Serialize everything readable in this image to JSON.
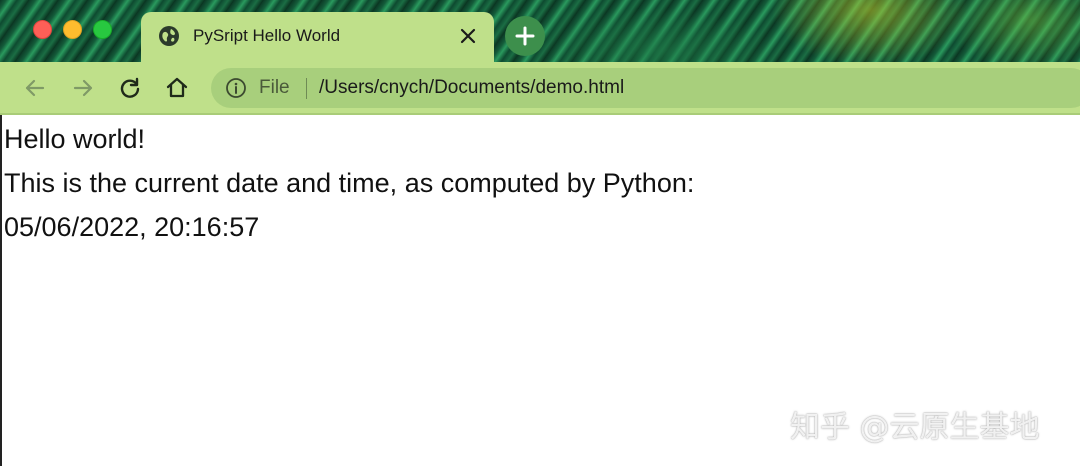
{
  "browser": {
    "tab": {
      "title": "PySript Hello World",
      "favicon": "globe-icon",
      "close_icon": "close-icon"
    },
    "new_tab_icon": "plus-icon",
    "toolbar": {
      "back_icon": "arrow-left-icon",
      "forward_icon": "arrow-right-icon",
      "reload_icon": "reload-icon",
      "home_icon": "home-icon"
    },
    "address_bar": {
      "info_icon": "info-icon",
      "scheme_label": "File",
      "url": "/Users/cnych/Documents/demo.html"
    },
    "colors": {
      "tab_bg": "#bfe08a",
      "toolbar_bg": "#bfe08a",
      "omnibox_bg": "#a8cf7c",
      "close": "#fe5f57",
      "minimize": "#febc2e",
      "maximize": "#28c840"
    }
  },
  "page": {
    "lines": [
      "Hello world!",
      "This is the current date and time, as computed by Python:",
      "05/06/2022, 20:16:57"
    ]
  },
  "watermark": "知乎 @云原生基地"
}
